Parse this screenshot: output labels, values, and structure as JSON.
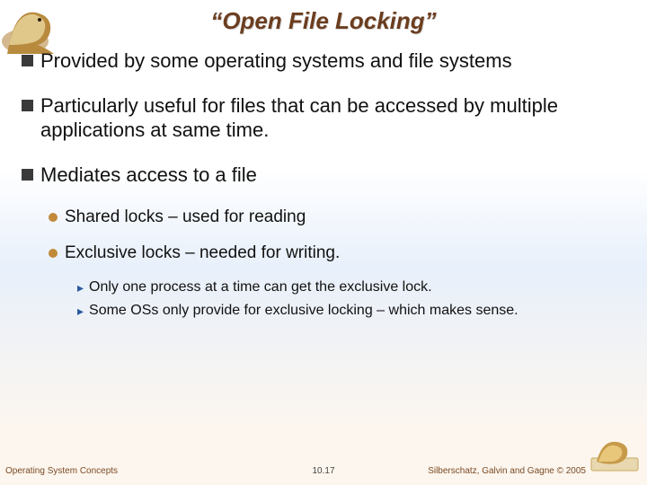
{
  "title": "“Open File Locking”",
  "bullets": [
    {
      "level": 1,
      "text": "Provided by some operating systems and file systems"
    },
    {
      "level": 1,
      "text": "Particularly useful for files that can be accessed by multiple applications at same time."
    },
    {
      "level": 1,
      "text": "Mediates access to a file"
    },
    {
      "level": 2,
      "text": "Shared locks – used for reading"
    },
    {
      "level": 2,
      "text": "Exclusive locks – needed for writing."
    },
    {
      "level": 3,
      "text": "Only one process at a time can get the exclusive lock."
    },
    {
      "level": 3,
      "text": "Some OSs only provide for exclusive locking – which makes sense."
    }
  ],
  "footer": {
    "left": "Operating System Concepts",
    "center": "10.17",
    "right": "Silberschatz, Galvin and Gagne © 2005"
  },
  "icons": {
    "dino_top": "dinosaur-mascot",
    "dino_bottom": "dinosaur-mascot-small"
  }
}
